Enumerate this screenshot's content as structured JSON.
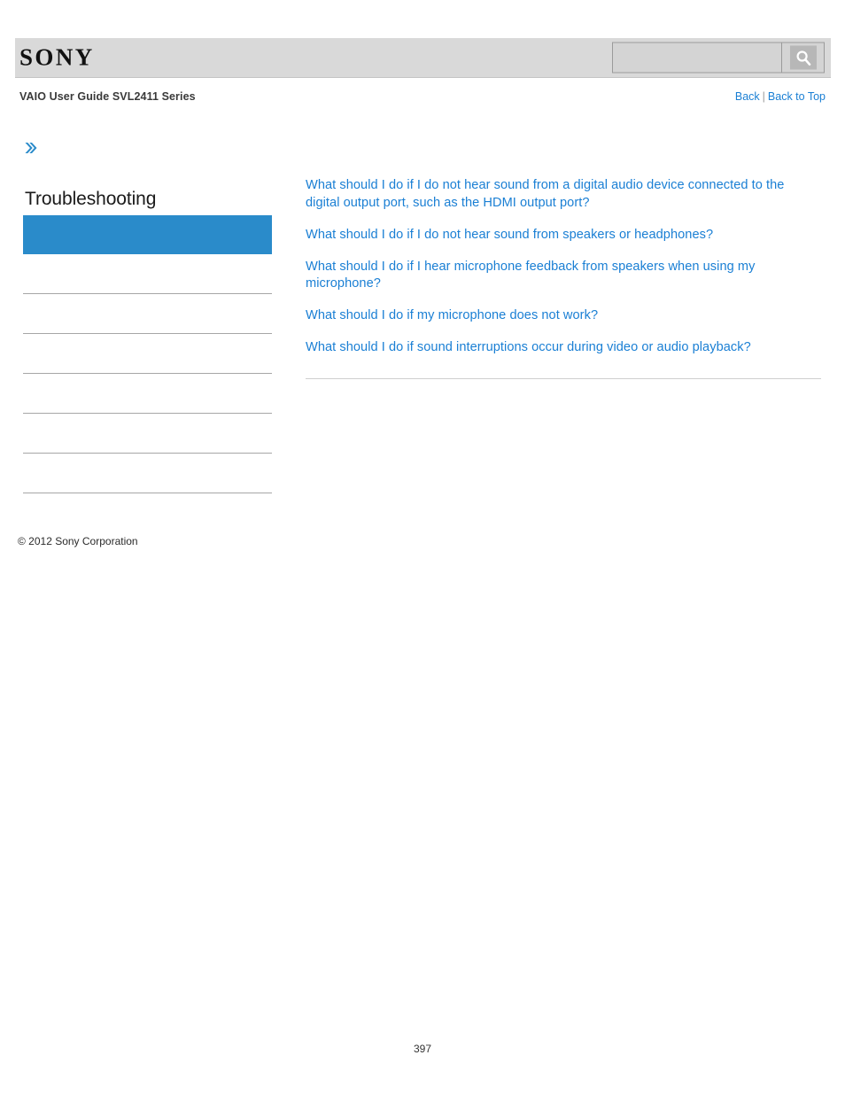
{
  "header": {
    "logo_text": "SONY",
    "search": {
      "value": "",
      "placeholder": "",
      "button_icon": "search-icon"
    }
  },
  "title_row": {
    "guide_title": "VAIO User Guide SVL2411 Series",
    "back_label": "Back",
    "separator": "|",
    "back_to_top_label": "Back to Top"
  },
  "sidebar": {
    "chevron_icon": "double-chevron-right-icon",
    "heading": "Troubleshooting",
    "selected_item_label": "",
    "items": [
      {
        "label": ""
      },
      {
        "label": ""
      },
      {
        "label": ""
      },
      {
        "label": ""
      },
      {
        "label": ""
      },
      {
        "label": ""
      }
    ]
  },
  "content": {
    "links": [
      "What should I do if I do not hear sound from a digital audio device connected to the digital output port, such as the HDMI output port?",
      "What should I do if I do not hear sound from speakers or headphones?",
      "What should I do if I hear microphone feedback from speakers when using my microphone?",
      "What should I do if my microphone does not work?",
      "What should I do if sound interruptions occur during video or audio playback?"
    ]
  },
  "footer": {
    "copyright": "© 2012 Sony Corporation",
    "page_number": "397"
  },
  "colors": {
    "link_blue": "#1a7fd4",
    "selected_blue": "#2a8bca",
    "header_gray": "#d9d9d9"
  }
}
